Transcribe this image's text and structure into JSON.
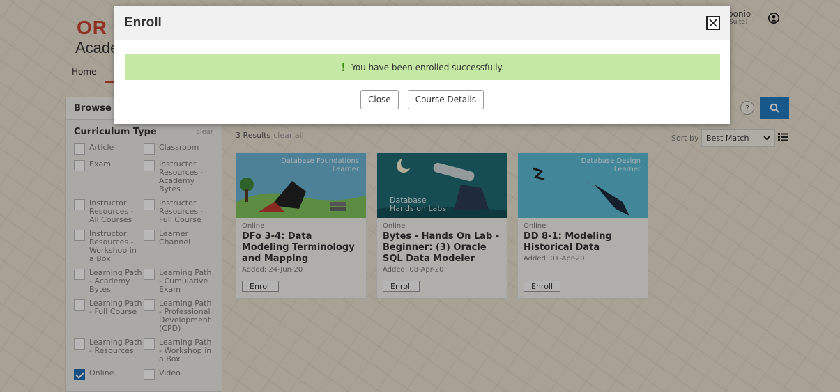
{
  "brand": {
    "oracle": "OR",
    "academy": "Acade"
  },
  "nav": {
    "home": "Home"
  },
  "user": {
    "name": "ponio",
    "sub": "Suite)"
  },
  "help_label": "?",
  "sidebar": {
    "title": "Browse Ca",
    "section_label": "Curriculum Type",
    "clear_label": "clear",
    "filters": [
      {
        "label": "Article",
        "checked": false
      },
      {
        "label": "Classroom",
        "checked": false
      },
      {
        "label": "Exam",
        "checked": false
      },
      {
        "label": "Instructor Resources - Academy Bytes",
        "checked": false
      },
      {
        "label": "Instructor Resources - All Courses",
        "checked": false
      },
      {
        "label": "Instructor Resources - Full Course",
        "checked": false
      },
      {
        "label": "Instructor Resources - Workshop in a Box",
        "checked": false
      },
      {
        "label": "Learner Channel",
        "checked": false
      },
      {
        "label": "Learning Path - Academy Bytes",
        "checked": false
      },
      {
        "label": "Learning Path - Cumulative Exam",
        "checked": false
      },
      {
        "label": "Learning Path - Full Course",
        "checked": false
      },
      {
        "label": "Learning Path - Professional Development (CPD)",
        "checked": false
      },
      {
        "label": "Learning Path - Resources",
        "checked": false
      },
      {
        "label": "Learning Path - Workshop in a Box",
        "checked": false
      },
      {
        "label": "Online",
        "checked": true
      },
      {
        "label": "Video",
        "checked": false
      }
    ]
  },
  "results": {
    "count": "3 Results",
    "clear_all": "clear all"
  },
  "sort": {
    "label": "Sort by",
    "value": "Best Match"
  },
  "cards": [
    {
      "thumb_text": "Database Foundations\nLearner",
      "thumb_color": "#5aa7c9",
      "mode": "Online",
      "title": "DFo 3-4: Data Modeling Terminology and Mapping",
      "added": "Added: 24-Jun-20",
      "enroll": "Enroll"
    },
    {
      "thumb_text": "Database\nHands on Labs",
      "thumb_color": "#1e6a73",
      "mode": "Online",
      "title": "Bytes - Hands On Lab - Beginner: (3) Oracle SQL Data Modeler",
      "added": "Added: 08-Apr-20",
      "enroll": "Enroll"
    },
    {
      "thumb_text": "Database Design\nLearner",
      "thumb_color": "#4fb3cf",
      "mode": "Online",
      "title": "DD 8-1: Modeling Historical Data",
      "added": "Added: 01-Apr-20",
      "enroll": "Enroll"
    }
  ],
  "modal": {
    "title": "Enroll",
    "alert_icon": "!",
    "alert_text": "You have been enrolled successfully.",
    "close_button": "Close",
    "details_button": "Course Details"
  },
  "colors": {
    "accent": "#1f7bbf",
    "brand": "#c74634",
    "success_bg": "#c5e9a4"
  },
  "icons": [
    "close-x-icon",
    "user-icon",
    "search-icon",
    "help-icon",
    "chevron-down-icon",
    "list-view-icon",
    "checkbox-icon",
    "alert-exclamation-icon"
  ]
}
